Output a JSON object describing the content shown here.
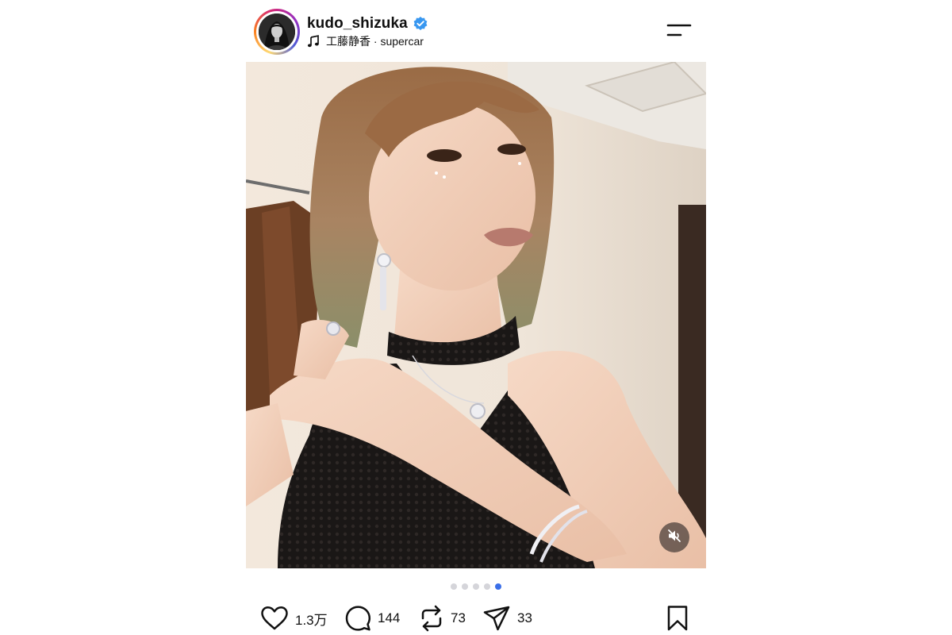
{
  "post": {
    "username": "kudo_shizuka",
    "verified": true,
    "music": {
      "artist": "工藤静香",
      "separator": "·",
      "song": "supercar",
      "text": "工藤静香 · supercar"
    },
    "media": {
      "type": "video",
      "muted": true,
      "carousel": {
        "total": 5,
        "active_index": 4
      }
    },
    "actions": {
      "likes": "1.3万",
      "comments": "144",
      "reposts": "73",
      "shares": "33"
    },
    "icons": {
      "verified": "verified-badge-icon",
      "music": "music-note-icon",
      "menu": "menu-icon",
      "mute": "speaker-muted-icon",
      "like": "heart-icon",
      "comment": "comment-icon",
      "repost": "repost-icon",
      "share": "send-icon",
      "save": "bookmark-icon"
    },
    "colors": {
      "verified_blue": "#3897f0",
      "active_dot": "#3b6fe8",
      "inactive_dot": "#d5d5da"
    }
  }
}
